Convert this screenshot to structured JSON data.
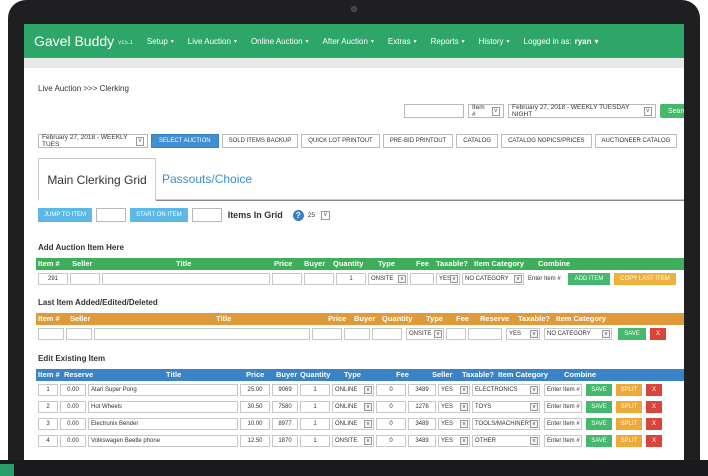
{
  "nav": {
    "brand": "Gavel Buddy",
    "version": "v15.1",
    "items": [
      "Setup",
      "Live Auction",
      "Online Auction",
      "After Auction",
      "Extras",
      "Reports",
      "History"
    ],
    "user_prefix": "Logged in as:",
    "user": "ryan"
  },
  "breadcrumb": "Live Auction >>> Clerking",
  "search": {
    "field_value": "",
    "type_select": "Item #",
    "date_select": "February 27, 2018 - WEEKLY TUESDAY NIGHT",
    "button": "Search"
  },
  "toolbar": {
    "auction_select": "February 27, 2018 - WEEKLY TUES",
    "select_auction": "SELECT AUCTION",
    "buttons": [
      "SOLD ITEMS BACKUP",
      "QUICK LOT PRINTOUT",
      "PRE-BID PRINTOUT",
      "CATALOG",
      "CATALOG NOPICS/PRICES",
      "AUCTIONEER CATALOG"
    ]
  },
  "tabs": {
    "active": "Main Clerking Grid",
    "other": "Passouts/Choice"
  },
  "jump": {
    "jump_button": "JUMP TO ITEM",
    "start_button": "START ON ITEM",
    "items_label": "Items In Grid",
    "help_glyph": "?",
    "items_value": "25"
  },
  "add_section": {
    "title": "Add Auction Item Here",
    "headers": [
      "Item #",
      "Seller",
      "Title",
      "Price",
      "Buyer",
      "Quantity",
      "Type",
      "Fee",
      "Taxable?",
      "Item Category",
      "Combine"
    ],
    "row": {
      "item": "291",
      "quantity": "1",
      "type": "ONSITE",
      "taxable": "YES",
      "category": "NO CATEGORY",
      "combine_placeholder": "Enter Item #",
      "add_button": "ADD ITEM",
      "copy_button": "COPY LAST ITEM"
    }
  },
  "last_section": {
    "title": "Last Item Added/Edited/Deleted",
    "headers": [
      "Item #",
      "Seller",
      "Title",
      "Price",
      "Buyer",
      "Quantity",
      "Type",
      "Fee",
      "Reserve",
      "Taxable?",
      "Item Category"
    ],
    "row": {
      "type": "ONSITE",
      "taxable": "YES",
      "category": "NO CATEGORY",
      "save": "SAVE",
      "delete": "X"
    }
  },
  "edit_section": {
    "title": "Edit Existing Item",
    "headers": [
      "Item #",
      "Reserve",
      "Title",
      "Price",
      "Buyer",
      "Quantity",
      "Type",
      "Fee",
      "Seller",
      "Taxable?",
      "Item Category",
      "Combine"
    ],
    "rows": [
      {
        "item": "1",
        "reserve": "0.00",
        "title": "Atari Super Pong",
        "price": "25.00",
        "buyer": "9069",
        "qty": "1",
        "type": "ONLINE",
        "fee": "0",
        "seller": "3489",
        "taxable": "YES",
        "category": "ELECTRONICS",
        "combine": "Enter Item #",
        "save": "SAVE",
        "split": "SPLIT",
        "x": "X"
      },
      {
        "item": "2",
        "reserve": "0.00",
        "title": "Hot Wheels",
        "price": "30.50",
        "buyer": "7580",
        "qty": "1",
        "type": "ONLINE",
        "fee": "0",
        "seller": "1276",
        "taxable": "YES",
        "category": "TOYS",
        "combine": "Enter Item #",
        "save": "SAVE",
        "split": "SPLIT",
        "x": "X"
      },
      {
        "item": "3",
        "reserve": "0.00",
        "title": "Electrunix Bender",
        "price": "10.00",
        "buyer": "8977",
        "qty": "1",
        "type": "ONLINE",
        "fee": "0",
        "seller": "3489",
        "taxable": "YES",
        "category": "TOOLS/MACHINERY",
        "combine": "Enter Item #",
        "save": "SAVE",
        "split": "SPLIT",
        "x": "X"
      },
      {
        "item": "4",
        "reserve": "0.00",
        "title": "Volkswagen Beetle phone",
        "price": "12.50",
        "buyer": "1870",
        "qty": "1",
        "type": "ONSITE",
        "fee": "0",
        "seller": "3489",
        "taxable": "YES",
        "category": "OTHER",
        "combine": "Enter Item #",
        "save": "SAVE",
        "split": "SPLIT",
        "x": "X"
      }
    ]
  },
  "icons": {
    "caret": "▾",
    "select_arrow": "v"
  },
  "colors": {
    "nav": "#2ea66a",
    "add_header": "#3fae5a",
    "last_header": "#e09a3a",
    "edit_header": "#3a83c6",
    "save": "#45b86e",
    "split": "#efa83a",
    "delete": "#d9453a"
  }
}
